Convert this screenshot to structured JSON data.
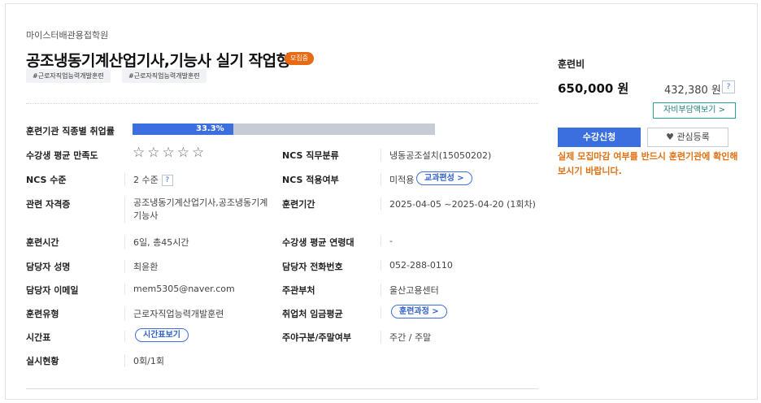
{
  "course": {
    "institution": "마이스터배관용접학원",
    "title": "공조냉동기계산업기사,기능사 실기 작업형",
    "status_badge": "모집중",
    "tags": [
      "#근로자직업능력개발훈련",
      "#근로자직업능력개발훈련"
    ]
  },
  "info": {
    "employment_rate_label": "훈련기관 직종별 취업률",
    "employment_rate_text": "33.3%",
    "employment_rate_value": 33.3,
    "satisfaction_label": "수강생 평균 만족도",
    "stars_text": "☆☆☆☆☆",
    "satisfaction_rating": 0,
    "ncs_category_label": "NCS 직무분류",
    "ncs_category_value": "냉동공조설치(15050202)",
    "ncs_level_label": "NCS 수준",
    "ncs_level_value": "2 수준",
    "ncs_level_help": "?",
    "ncs_apply_label": "NCS 적용여부",
    "ncs_apply_value": "미적용",
    "ncs_apply_button": "교과편성 >",
    "cert_label": "관련 자격증",
    "cert_value": "공조냉동기계산업기사,공조냉동기계기능사",
    "period_label": "훈련기간",
    "period_value": "2025-04-05 ~2025-04-20 (1회차)",
    "hours_label": "훈련시간",
    "hours_value": "6일, 총45시간",
    "age_label": "수강생 평균 연령대",
    "age_value": "-",
    "manager_label": "담당자 성명",
    "manager_value": "최윤환",
    "phone_label": "담당자 전화번호",
    "phone_value": "052-288-0110",
    "email_label": "담당자 이메일",
    "email_value": "mem5305@naver.com",
    "dept_label": "주관부처",
    "dept_value": "울산고용센터",
    "type_label": "훈련유형",
    "type_value": "근로자직업능력개발훈련",
    "wage_label": "취업처 임금평균",
    "wage_button": "훈련과정 >",
    "timetable_label": "시간표",
    "timetable_button": "시간표보기",
    "daynight_label": "주야구분/주말여부",
    "daynight_value": "주간 / 주말",
    "progress_label": "실시현황",
    "progress_value": "0회/1회"
  },
  "fee": {
    "label": "훈련비",
    "price": "650,000 원",
    "self_pay": "432,380 원",
    "help": "?",
    "self_pay_button": "자비부담액보기 >",
    "apply_button": "수강신청",
    "favorite_button": "관심등록",
    "notice": "실제 모집마감 여부를 반드시 훈련기관에 확인해보시기 바랍니다."
  },
  "colors": {
    "accent": "#3b6fe0",
    "badge": "#e86a12",
    "notice": "#e07112",
    "teal": "#2aa198"
  },
  "icons": {
    "favorite": "heart-icon",
    "rating": "star-icon"
  }
}
